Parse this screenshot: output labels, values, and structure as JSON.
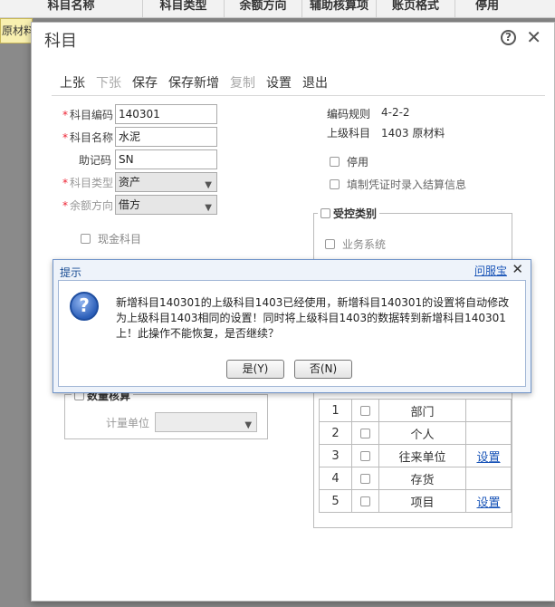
{
  "background": {
    "columns": [
      "科目名称",
      "科目类型",
      "余额方向",
      "辅助核算项",
      "账页格式",
      "停用"
    ],
    "row_text": "原材料"
  },
  "dialog": {
    "title": "科目",
    "help_icon": "?",
    "close_icon": "✕",
    "toolbar": [
      "上张",
      "下张",
      "保存",
      "保存新增",
      "复制",
      "设置",
      "退出"
    ],
    "fields": {
      "code_label": "科目编码",
      "code_value": "140301",
      "name_label": "科目名称",
      "name_value": "水泥",
      "mnemonic_label": "助记码",
      "mnemonic_value": "SN",
      "type_label": "科目类型",
      "type_value": "资产",
      "direction_label": "余额方向",
      "direction_value": "借方",
      "cash_label": "现金科目"
    },
    "right": {
      "rule_label": "编码规则",
      "rule_value": "4-2-2",
      "parent_label": "上级科目",
      "parent_value": "1403  原材料",
      "disabled_label": "停用",
      "settle_label": "填制凭证时录入结算信息"
    },
    "controlled": {
      "title": "受控类别",
      "business_system": "业务系统"
    },
    "quantity": {
      "title": "数量核算",
      "unit_label": "计量单位"
    },
    "aux_table": [
      {
        "no": "1",
        "name": "部门",
        "link": ""
      },
      {
        "no": "2",
        "name": "个人",
        "link": ""
      },
      {
        "no": "3",
        "name": "往来单位",
        "link": "设置"
      },
      {
        "no": "4",
        "name": "存货",
        "link": ""
      },
      {
        "no": "5",
        "name": "项目",
        "link": "设置"
      }
    ]
  },
  "prompt": {
    "title": "提示",
    "service_link": "问服宝",
    "close_icon": "✕",
    "message": "新增科目140301的上级科目1403已经使用，新增科目140301的设置将自动修改为上级科目1403相同的设置！同时将上级科目1403的数据转到新增科目140301上！此操作不能恢复，是否继续？",
    "yes_button": "是(Y)",
    "no_button": "否(N)"
  }
}
